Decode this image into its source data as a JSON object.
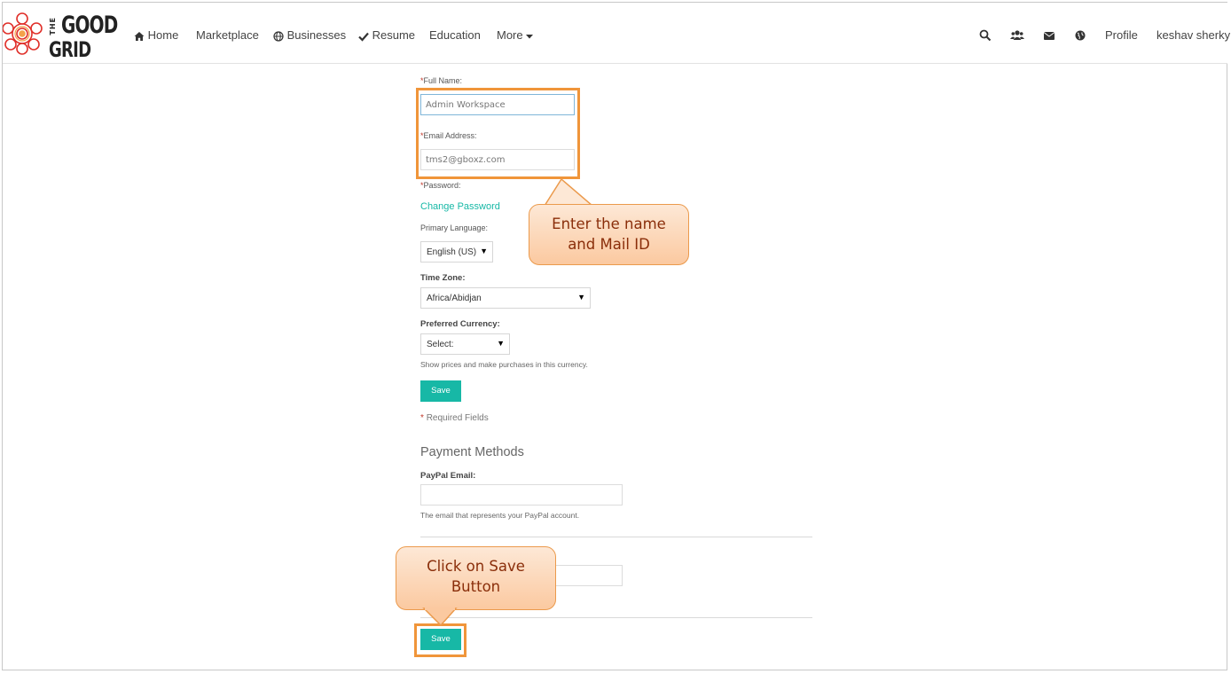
{
  "brand": {
    "the": "THE",
    "good": "GOOD",
    "grid": "GRID"
  },
  "nav": {
    "home": "Home",
    "marketplace": "Marketplace",
    "businesses": "Businesses",
    "resume": "Resume",
    "education": "Education",
    "more": "More",
    "profile": "Profile",
    "user": "keshav sherky"
  },
  "form": {
    "full_name_label": "Full Name:",
    "full_name_value": "Admin Workspace",
    "email_label": "Email Address:",
    "email_value": "tms2@gboxz.com",
    "password_label": "Password:",
    "change_password": "Change Password",
    "primary_language_label": "Primary Language:",
    "primary_language_value": "English (US)",
    "time_zone_label": "Time Zone:",
    "time_zone_value": "Africa/Abidjan",
    "currency_label": "Preferred Currency:",
    "currency_value": "Select:",
    "currency_help": "Show prices and make purchases in this currency.",
    "save_label": "Save",
    "required_marker": "*",
    "required_note": "Required Fields"
  },
  "payment": {
    "heading": "Payment Methods",
    "paypal_label": "PayPal Email:",
    "paypal_value": "",
    "paypal_help": "The email that represents your PayPal account.",
    "save_label": "Save"
  },
  "callouts": {
    "name_mail": [
      "Enter the name",
      "and Mail ID"
    ],
    "save": [
      "Click on Save",
      "Button"
    ]
  },
  "colors": {
    "accent": "#17b8a6",
    "highlight": "#f0953a",
    "callout_text": "#8a2e0a"
  }
}
